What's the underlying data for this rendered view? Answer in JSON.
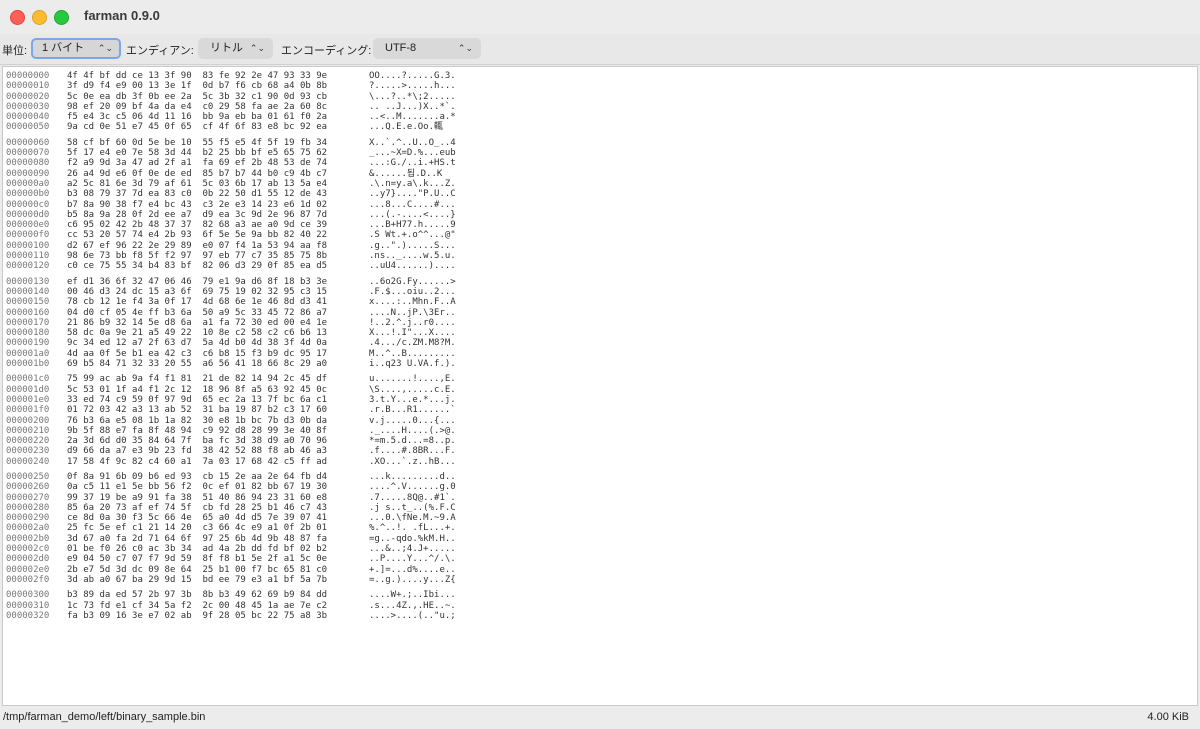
{
  "window": {
    "title": "farman 0.9.0"
  },
  "toolbar": {
    "unit_label": "単位:",
    "unit_value": "1 バイト",
    "endian_label": "エンディアン:",
    "endian_value": "リトル",
    "encoding_label": "エンコーディング:",
    "encoding_value": "UTF-8"
  },
  "rows": [
    {
      "a": "00000000",
      "h": "4f 4f bf dd ce 13 3f 90  83 fe 92 2e 47 93 33 9e",
      "t": "OO....?.....G.3."
    },
    {
      "a": "00000010",
      "h": "3f d9 f4 e9 00 13 3e 1f  0d b7 f6 cb 68 a4 0b 8b",
      "t": "?.....>.....h..."
    },
    {
      "a": "00000020",
      "h": "5c 0e ea db 3f 0b ee 2a  5c 3b 32 c1 90 0d 93 cb",
      "t": "\\...?..*\\;2....."
    },
    {
      "a": "00000030",
      "h": "98 ef 20 09 bf 4a da e4  c0 29 58 fa ae 2a 60 8c",
      "t": ".. ..J...)X..*`."
    },
    {
      "a": "00000040",
      "h": "f5 e4 3c c5 06 4d 11 16  bb 9a eb ba 01 61 f0 2a",
      "t": "..<..M.......a.*"
    },
    {
      "a": "00000050",
      "h": "9a cd 0e 51 e7 45 0f 65  cf 4f 6f 83 e8 bc 92 ea",
      "t": "...Q.E.e.Oo.輒"
    },
    {
      "a": "00000060",
      "h": "58 cf bf 60 0d 5e be 10  55 f5 e5 4f 5f 19 fb 34",
      "t": "X..`.^..U..O_..4",
      "gap": true
    },
    {
      "a": "00000070",
      "h": "5f 17 e4 e0 7e 58 3d 44  b2 25 bb bf e5 65 75 62",
      "t": "_...~X=D.%...eub"
    },
    {
      "a": "00000080",
      "h": "f2 a9 9d 3a 47 ad 2f a1  fa 69 ef 2b 48 53 de 74",
      "t": "...:G./..i.+HS.t"
    },
    {
      "a": "00000090",
      "h": "26 a4 9d e6 0f 0e de ed  85 b7 b7 44 b0 c9 4b c7",
      "t": "&......됩.D..K"
    },
    {
      "a": "000000a0",
      "h": "a2 5c 81 6e 3d 79 af 61  5c 03 6b 17 ab 13 5a e4",
      "t": ".\\.n=y.a\\.k...Z."
    },
    {
      "a": "000000b0",
      "h": "b3 08 79 37 7d ea 83 c0  0b 22 50 d1 55 12 de 43",
      "t": "..y7}....\"P.U..C"
    },
    {
      "a": "000000c0",
      "h": "b7 8a 90 38 f7 e4 bc 43  c3 2e e3 14 23 e6 1d 02",
      "t": "...8...C....#..."
    },
    {
      "a": "000000d0",
      "h": "b5 8a 9a 28 0f 2d ee a7  d9 ea 3c 9d 2e 96 87 7d",
      "t": "...(.-....<....}"
    },
    {
      "a": "000000e0",
      "h": "c6 95 02 42 2b 48 37 37  82 68 a3 ae a0 9d ce 39",
      "t": "...B+H77.h.....9"
    },
    {
      "a": "000000f0",
      "h": "cc 53 20 57 74 e4 2b 93  6f 5e 5e 9a bb 82 40 22",
      "t": ".S Wt.+.o^^...@\""
    },
    {
      "a": "00000100",
      "h": "d2 67 ef 96 22 2e 29 89  e0 07 f4 1a 53 94 aa f8",
      "t": ".g..\".).....S..."
    },
    {
      "a": "00000110",
      "h": "98 6e 73 bb f8 5f f2 97  97 eb 77 c7 35 85 75 8b",
      "t": ".ns.._....w.5.u."
    },
    {
      "a": "00000120",
      "h": "c0 ce 75 55 34 b4 83 bf  82 06 d3 29 0f 85 ea d5",
      "t": "..uU4......)...."
    },
    {
      "a": "00000130",
      "h": "ef d1 36 6f 32 47 06 46  79 e1 9a d6 8f 18 b3 3e",
      "t": "..6o2G.Fy......>",
      "gap": true
    },
    {
      "a": "00000140",
      "h": "00 46 d3 24 dc 15 a3 6f  69 75 19 02 32 95 c3 15",
      "t": ".F.$...oiu..2..."
    },
    {
      "a": "00000150",
      "h": "78 cb 12 1e f4 3a 0f 17  4d 68 6e 1e 46 8d d3 41",
      "t": "x....:..Mhn.F..A"
    },
    {
      "a": "00000160",
      "h": "04 d0 cf 05 4e ff b3 6a  50 a9 5c 33 45 72 86 a7",
      "t": "....N..jP.\\3Er.."
    },
    {
      "a": "00000170",
      "h": "21 86 b9 32 14 5e d8 6a  a1 fa 72 30 ed 00 e4 1e",
      "t": "!..2.^.j..r0...."
    },
    {
      "a": "00000180",
      "h": "58 dc 0a 9e 21 a5 49 22  10 8e c2 58 c2 c6 b6 13",
      "t": "X...!.I\"...X...."
    },
    {
      "a": "00000190",
      "h": "9c 34 ed 12 a7 2f 63 d7  5a 4d b0 4d 38 3f 4d 0a",
      "t": ".4.../c.ZM.M8?M."
    },
    {
      "a": "000001a0",
      "h": "4d aa 0f 5e b1 ea 42 c3  c6 b8 15 f3 b9 dc 95 17",
      "t": "M..^..B........."
    },
    {
      "a": "000001b0",
      "h": "69 b5 84 71 32 33 20 55  a6 56 41 18 66 8c 29 a0",
      "t": "i..q23 U.VA.f.)."
    },
    {
      "a": "000001c0",
      "h": "75 99 ac ab 9a f4 f1 81  21 de 82 14 94 2c 45 df",
      "t": "u.......!....,E.",
      "gap": true
    },
    {
      "a": "000001d0",
      "h": "5c 53 01 1f a4 f1 2c 12  18 96 8f a5 63 92 45 0c",
      "t": "\\S....,.....c.E."
    },
    {
      "a": "000001e0",
      "h": "33 ed 74 c9 59 0f 97 9d  65 ec 2a 13 7f bc 6a c1",
      "t": "3.t.Y...e.*...j."
    },
    {
      "a": "000001f0",
      "h": "01 72 03 42 a3 13 ab 52  31 ba 19 87 b2 c3 17 60",
      "t": ".r.B...R1......`"
    },
    {
      "a": "00000200",
      "h": "76 b3 6a e5 08 1b 1a 82  30 e8 1b bc 7b d3 0b da",
      "t": "v.j.....0...{..."
    },
    {
      "a": "00000210",
      "h": "9b 5f 88 e7 fa 8f 48 94  c9 92 d8 28 99 3e 40 8f",
      "t": "._....H....(.>@."
    },
    {
      "a": "00000220",
      "h": "2a 3d 6d d0 35 84 64 7f  ba fc 3d 38 d9 a0 70 96",
      "t": "*=m.5.d...=8..p."
    },
    {
      "a": "00000230",
      "h": "d9 66 da a7 e3 9b 23 fd  38 42 52 88 f8 ab 46 a3",
      "t": ".f....#.8BR...F."
    },
    {
      "a": "00000240",
      "h": "17 58 4f 9c 82 c4 60 a1  7a 03 17 68 42 c5 ff ad",
      "t": ".XO...`.z..hB..."
    },
    {
      "a": "00000250",
      "h": "0f 8a 91 6b 09 b6 ed 93  cb 15 2e aa 2e 64 fb d4",
      "t": "...k.........d..",
      "gap": true
    },
    {
      "a": "00000260",
      "h": "0a c5 11 e1 5e bb 56 f2  0c ef 01 82 bb 67 19 30",
      "t": "....^.V......g.0"
    },
    {
      "a": "00000270",
      "h": "99 37 19 be a9 91 fa 38  51 40 86 94 23 31 60 e8",
      "t": ".7.....8Q@..#1`."
    },
    {
      "a": "00000280",
      "h": "85 6a 20 73 af ef 74 5f  cb fd 28 25 b1 46 c7 43",
      "t": ".j s..t_..(%.F.C"
    },
    {
      "a": "00000290",
      "h": "ce 8d 0a 30 f3 5c 66 4e  65 a0 4d d5 7e 39 07 41",
      "t": "...0.\\fNe.M.~9.A"
    },
    {
      "a": "000002a0",
      "h": "25 fc 5e ef c1 21 14 20  c3 66 4c e9 a1 0f 2b 01",
      "t": "%.^..!. .fL...+."
    },
    {
      "a": "000002b0",
      "h": "3d 67 a0 fa 2d 71 64 6f  97 25 6b 4d 9b 48 87 fa",
      "t": "=g..-qdo.%kM.H.."
    },
    {
      "a": "000002c0",
      "h": "01 be f0 26 c0 ac 3b 34  ad 4a 2b dd fd bf 02 b2",
      "t": "...&..;4.J+....."
    },
    {
      "a": "000002d0",
      "h": "e9 04 50 c7 07 f7 9d 59  8f f8 b1 5e 2f a1 5c 0e",
      "t": "..P....Y...^/.\\."
    },
    {
      "a": "000002e0",
      "h": "2b e7 5d 3d dc 09 8e 64  25 b1 00 f7 bc 65 81 c0",
      "t": "+.]=...d%....e.."
    },
    {
      "a": "000002f0",
      "h": "3d ab a0 67 ba 29 9d 15  bd ee 79 e3 a1 bf 5a 7b",
      "t": "=..g.)....y...Z{"
    },
    {
      "a": "00000300",
      "h": "b3 89 da ed 57 2b 97 3b  8b b3 49 62 69 b9 84 dd",
      "t": "....W+.;..Ibi...",
      "gap": true
    },
    {
      "a": "00000310",
      "h": "1c 73 fd e1 cf 34 5a f2  2c 00 48 45 1a ae 7e c2",
      "t": ".s...4Z.,.HE..~."
    },
    {
      "a": "00000320",
      "h": "fa b3 09 16 3e e7 02 ab  9f 28 05 bc 22 75 a8 3b",
      "t": "....>....(..\"u.;"
    }
  ],
  "status": {
    "path": "/tmp/farman_demo/left/binary_sample.bin",
    "size": "4.00 KiB"
  }
}
